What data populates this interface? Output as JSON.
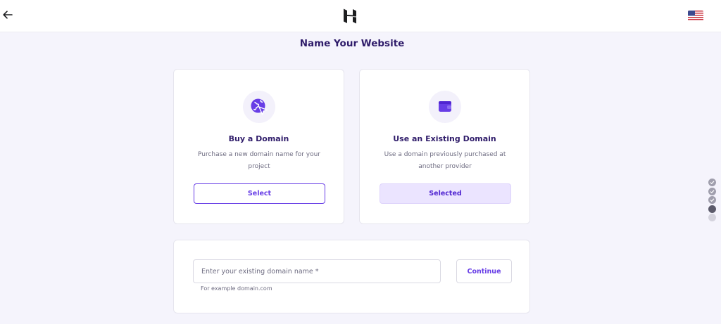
{
  "header": {
    "back_icon": "arrow-left-icon",
    "logo_icon": "hostinger-logo-icon",
    "language_flag": "us-flag-icon"
  },
  "page": {
    "title": "Name Your Website"
  },
  "options": [
    {
      "icon": "globe-cursor-icon",
      "heading": "Buy a Domain",
      "description": "Purchase a new domain name for your project",
      "button_label": "Select",
      "selected": false
    },
    {
      "icon": "wallet-icon",
      "heading": "Use an Existing Domain",
      "description": "Use a domain previously purchased at another provider",
      "button_label": "Selected",
      "selected": true
    }
  ],
  "domain_form": {
    "placeholder": "Enter your existing domain name *",
    "value": "",
    "hint": "For example domain.com",
    "continue_label": "Continue"
  },
  "progress": {
    "steps": [
      "done",
      "done",
      "done",
      "current",
      "todo"
    ]
  },
  "colors": {
    "accent": "#673de6",
    "text_dark": "#2f1c6a",
    "background": "#f5f4fc",
    "selected_bg": "#ebe4ff"
  }
}
